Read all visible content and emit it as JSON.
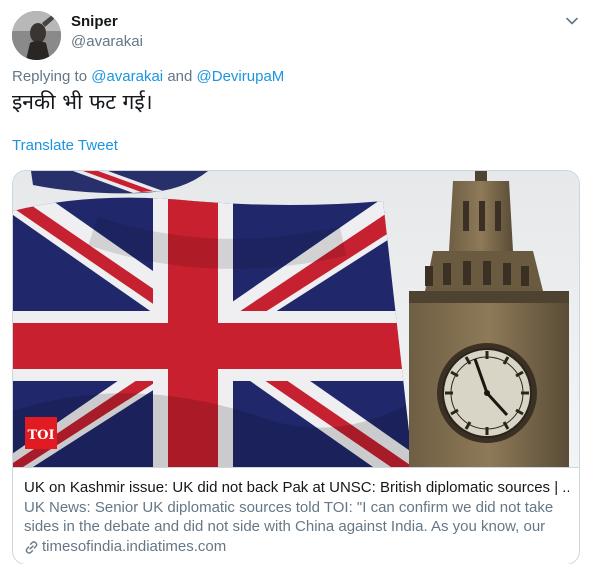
{
  "author": {
    "display_name": "Sniper",
    "handle": "@avarakai"
  },
  "reply": {
    "prefix": "Replying to",
    "mention1": "@avarakai",
    "conjunction": "and",
    "mention2": "@DevirupaM"
  },
  "tweet": {
    "text": "इनकी भी फट गई।",
    "translate_label": "Translate Tweet"
  },
  "card": {
    "logo_text": "TOI",
    "title": "UK on Kashmir issue: UK did not back Pak at UNSC: British diplomatic sources | ...",
    "description": "UK News: Senior UK diplomatic sources told TOI: \"I can confirm we did not take sides in the debate and did not side with China against India. As you know, our",
    "domain": "timesofindia.indiatimes.com"
  },
  "colors": {
    "link": "#1b95e0",
    "secondary_text": "#657786",
    "border": "#ccd6dd",
    "toi_red": "#e21b22"
  },
  "icons": {
    "caret": "chevron-down-icon",
    "link": "link-icon"
  }
}
